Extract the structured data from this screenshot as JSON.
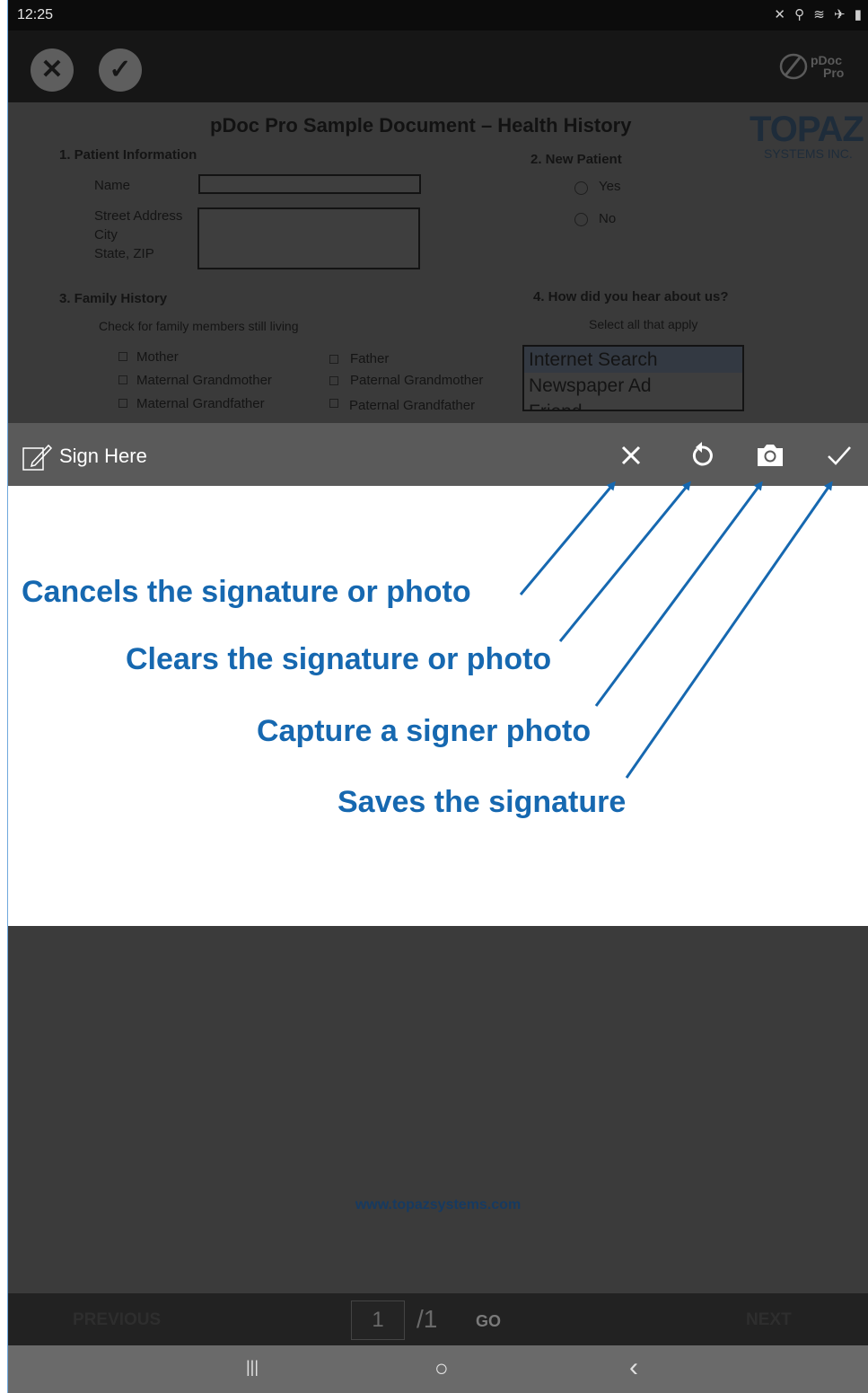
{
  "status_bar": {
    "time": "12:25",
    "icons": "✕ ⚲ ≋ ✈ ▮"
  },
  "app_bar": {
    "cancel_glyph": "✕",
    "confirm_glyph": "✓",
    "logo_text_1": "pDoc",
    "logo_text_2": "Pro"
  },
  "document": {
    "title": "pDoc Pro Sample Document – Health History",
    "logo_main": "TOPAZ",
    "logo_sub": "SYSTEMS INC.",
    "section1": {
      "heading": "1.  Patient Information",
      "name_label": "Name",
      "address_label_1": "Street Address",
      "address_label_2": "City",
      "address_label_3": "State, ZIP"
    },
    "section2": {
      "heading": "2.  New Patient",
      "options": [
        "Yes",
        "No"
      ]
    },
    "section3": {
      "heading": "3.  Family History",
      "instruction": "Check for family members still living",
      "members": [
        "Mother",
        "Maternal Grandmother",
        "Maternal Grandfather",
        "Father",
        "Paternal Grandmother",
        "Paternal Grandfather"
      ]
    },
    "section4": {
      "heading": "4.  How did you hear about us?",
      "instruction": "Select all that apply",
      "list_items": [
        "Internet Search",
        "Newspaper Ad",
        "Friend"
      ]
    }
  },
  "sign_bar": {
    "label": "Sign Here"
  },
  "annotations": {
    "cancel": "Cancels the signature or photo",
    "clear": "Clears the signature or photo",
    "photo": "Capture a signer photo",
    "save": "Saves the signature"
  },
  "footer": {
    "url": "www.topazsystems.com"
  },
  "pager": {
    "prev": "PREVIOUS",
    "page": "1",
    "total": "/1",
    "go": "GO",
    "next": "NEXT"
  },
  "nav_bar": {
    "recents": "|||",
    "home": "○",
    "back": "‹"
  },
  "colors": {
    "accent": "#1668b0",
    "sign_bar": "#5a5a5a"
  }
}
